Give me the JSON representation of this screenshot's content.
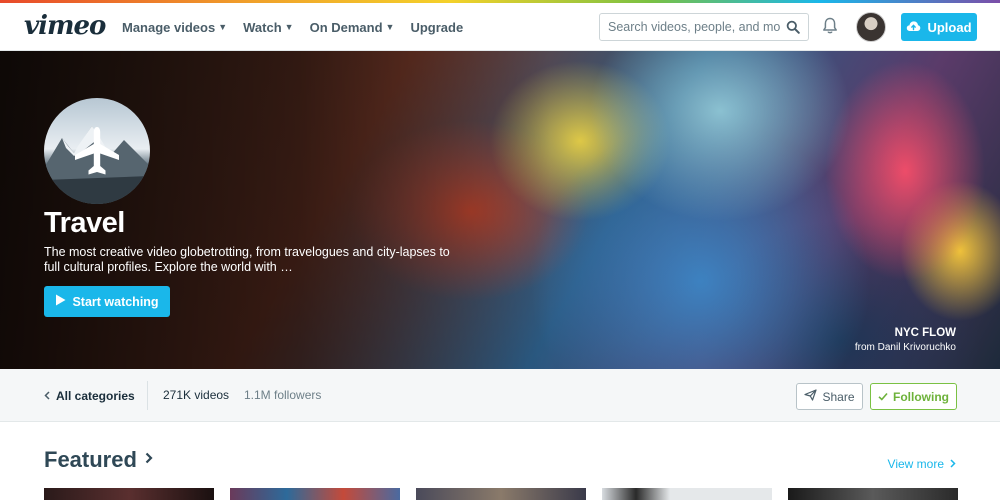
{
  "nav": {
    "logo": "vimeo",
    "links": [
      {
        "label": "Manage videos",
        "has_menu": true
      },
      {
        "label": "Watch",
        "has_menu": true
      },
      {
        "label": "On Demand",
        "has_menu": true
      },
      {
        "label": "Upgrade",
        "has_menu": false
      }
    ],
    "search_placeholder": "Search videos, people, and more",
    "upload_label": "Upload",
    "icons": {
      "search": "search-icon",
      "notifications": "bell-icon",
      "upload": "cloud-upload-icon"
    }
  },
  "hero": {
    "title": "Travel",
    "description": "The most creative video globetrotting, from travelogues and city-lapses to full cultural profiles. Explore the world with …",
    "cta_label": "Start watching",
    "badge_icon": "airplane-icon",
    "credit_title": "NYC FLOW",
    "credit_by": "from Danil Krivoruchko"
  },
  "category_bar": {
    "back_label": "All categories",
    "videos_count": "271K videos",
    "followers_count": "1.1M followers",
    "share_label": "Share",
    "follow_label": "Following"
  },
  "featured": {
    "title": "Featured",
    "view_more_label": "View more"
  },
  "colors": {
    "accent": "#1ab7ea",
    "follow_green": "#6db23a",
    "text_dark": "#1a2e3b"
  }
}
